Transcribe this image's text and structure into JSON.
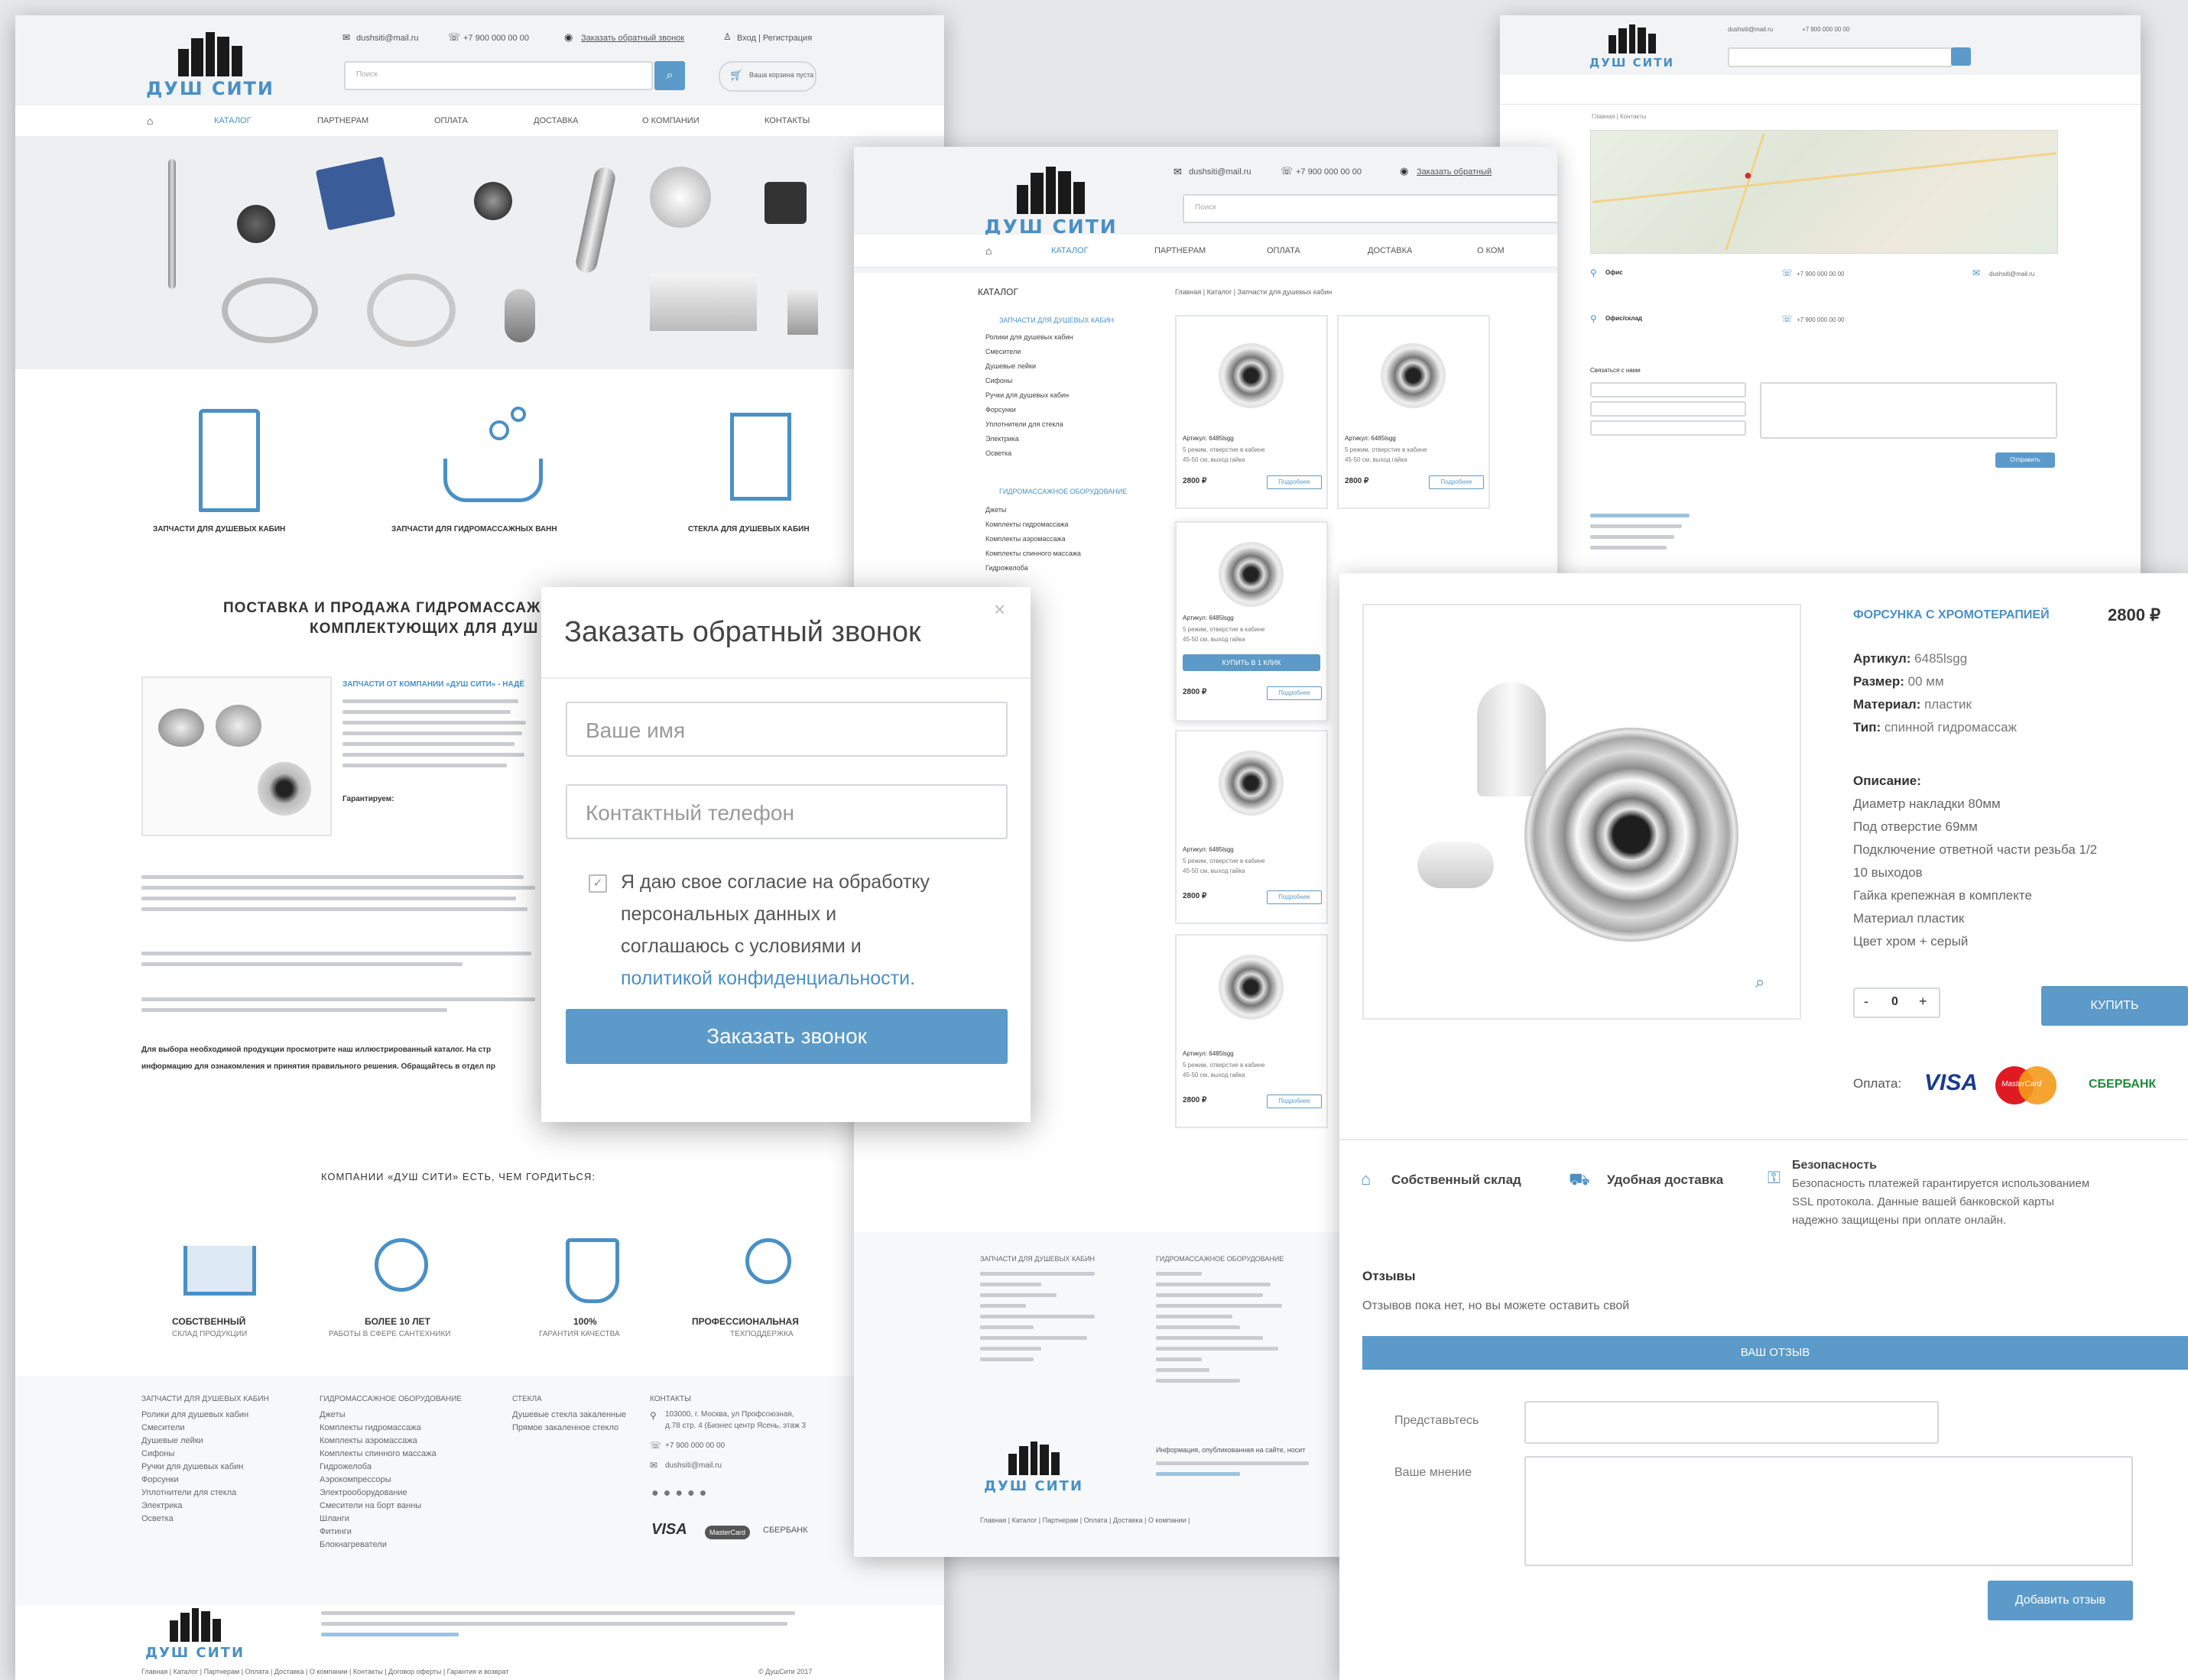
{
  "brand": {
    "name": "ДУШ СИТИ"
  },
  "colors": {
    "accent": "#4a90c5",
    "button": "#5b9ac9",
    "bg": "#e6e7e9"
  },
  "home": {
    "header": {
      "email": "dushsiti@mail.ru",
      "phone": "+7 900 000 00 00",
      "callback_link": "Заказать обратный звонок",
      "login": "Вход | Регистрация",
      "search_placeholder": "Поиск",
      "cart_label": "Ваша корзина пуста"
    },
    "nav": [
      "КАТАЛОГ",
      "ПАРТНЕРАМ",
      "ОПЛАТА",
      "ДОСТАВКА",
      "О КОМПАНИИ",
      "КОНТАКТЫ"
    ],
    "categories": [
      "ЗАПЧАСТИ ДЛЯ ДУШЕВЫХ КАБИН",
      "ЗАПЧАСТИ ДЛЯ ГИДРОМАССАЖНЫХ ВАНН",
      "СТЕКЛА ДЛЯ ДУШЕВЫХ КАБИН"
    ],
    "section_title_1": "ПОСТАВКА И ПРОДАЖА ГИДРОМАССАЖ",
    "section_title_2": "КОМПЛЕКТУЮЩИХ ДЛЯ ДУШ",
    "intro_link": "ЗАПЧАСТИ ОТ КОМПАНИИ «ДУШ СИТИ» - НАДЁ",
    "guarantee": "Гарантируем:",
    "bold_note_1": "Для выбора необходимой продукции просмотрите наш иллюстрированный каталог. На стр",
    "bold_note_2": "информацию для ознакомления и принятия правильного решения. Обращайтесь в отдел пр",
    "proud_title": "КОМПАНИИ «ДУШ СИТИ» ЕСТЬ, ЧЕМ ГОРДИТЬСЯ:",
    "features": [
      {
        "title": "СОБСТВЕННЫЙ",
        "sub": "СКЛАД ПРОДУКЦИИ"
      },
      {
        "title": "БОЛЕЕ 10 ЛЕТ",
        "sub": "РАБОТЫ В СФЕРЕ САНТЕХНИКИ"
      },
      {
        "title": "100%",
        "sub": "ГАРАНТИЯ КАЧЕСТВА"
      },
      {
        "title": "ПРОФЕССИОНАЛЬНАЯ",
        "sub": "ТЕХПОДДЕРЖКА"
      }
    ],
    "footer_cols": [
      {
        "title": "ЗАПЧАСТИ ДЛЯ ДУШЕВЫХ КАБИН",
        "items": [
          "Ролики для душевых кабин",
          "Смесители",
          "Душевые лейки",
          "Сифоны",
          "Ручки для душевых кабин",
          "Форсунки",
          "Уплотнители для стекла",
          "Электрика",
          "Осветка"
        ]
      },
      {
        "title": "ГИДРОМАССАЖНОЕ ОБОРУДОВАНИЕ",
        "items": [
          "Джеты",
          "Комплекты гидромассажа",
          "Комплекты аэромассажа",
          "Комплекты спинного массажа",
          "Гидрожелоба",
          "Аэрокомпрессоры",
          "Электрооборудование",
          "Смесители на борт ванны",
          "Шланги",
          "Фитинги",
          "Блокнагреватели"
        ]
      },
      {
        "title": "СТЕКЛА",
        "items": [
          "Душевые стекла закаленные",
          "Прямое закаленное стекло"
        ]
      },
      {
        "title": "КОНТАКТЫ",
        "items": [
          "103000, г. Москва, ул Профсоюзная,",
          "д.78 стр. 4 (Бизнес центр Ясень, этаж 3",
          "+7 900 000 00 00",
          "dushsiti@mail.ru"
        ]
      }
    ],
    "payments": [
      "VISA",
      "MasterCard",
      "СБЕРБАНК"
    ],
    "copyright": "© ДушСити 2017",
    "bottom_links": "Главная | Каталог | Партнерам | Оплата | Доставка | О компании | Контакты | Договор оферты | Гарантия и возврат"
  },
  "modal": {
    "title": "Заказать обратный звонок",
    "close": "×",
    "name_placeholder": "Ваше имя",
    "phone_placeholder": "Контактный телефон",
    "consent_1": "Я даю свое согласие на обработку",
    "consent_2": "персональных данных и",
    "consent_3": "соглашаюсь с условиями и",
    "consent_link": "политикой конфиденциальности.",
    "submit": "Заказать звонок"
  },
  "catalog": {
    "header_email": "dushsiti@mail.ru",
    "header_phone": "+7 900 000 00 00",
    "header_callback": "Заказать обратный",
    "search_placeholder": "Поиск",
    "nav": [
      "КАТАЛОГ",
      "ПАРТНЕРАМ",
      "ОПЛАТА",
      "ДОСТАВКА",
      "О КОМ"
    ],
    "sidebar_title": "КАТАЛОГ",
    "breadcrumb": "Главная | Каталог | Запчасти для душевых кабин",
    "group1_title": "ЗАПЧАСТИ ДЛЯ ДУШЕВЫХ КАБИН",
    "group1_items": [
      "Ролики для душевых кабин",
      "Смесители",
      "Душевые лейки",
      "Сифоны",
      "Ручки для душевых кабин",
      "Форсунки",
      "Уплотнители для стекла",
      "Электрика",
      "Осветка"
    ],
    "group2_title": "ГИДРОМАССАЖНОЕ ОБОРУДОВАНИЕ",
    "group2_items": [
      "Джеты",
      "Комплекты гидромассажа",
      "Комплекты аэромассажа",
      "Комплекты спинного массажа",
      "Гидрожелоба"
    ],
    "product": {
      "sku": "Артикул: 6485lsgg",
      "desc1": "5 режим, отверстие в кабине",
      "desc2": "45-50 см, выход гайка",
      "price": "2800 ₽",
      "more": "Подробнее",
      "buy": "КУПИТЬ В 1 КЛИК"
    },
    "footer_info": "Информация, опубликованная на сайте, носит",
    "bottom_links": "Главная | Каталог | Партнерам | Оплата | Доставка | О компании |"
  },
  "contacts": {
    "breadcrumb": "Главная | Контакты",
    "office1": "Офис",
    "office2": "Офис/склад",
    "phone": "+7 900 000 00 00",
    "email": "dushsiti@mail.ru",
    "form_title": "Связаться с нами",
    "send": "Отправить"
  },
  "product": {
    "title": "ФОРСУНКА С ХРОМОТЕРАПИЕЙ",
    "price": "2800 ₽",
    "specs": [
      {
        "k": "Артикул:",
        "v": "6485lsgg"
      },
      {
        "k": "Размер:",
        "v": "00 мм"
      },
      {
        "k": "Материал:",
        "v": "пластик"
      },
      {
        "k": "Тип:",
        "v": "спинной гидромассаж"
      }
    ],
    "desc_title": "Описание:",
    "desc": [
      "Диаметр накладки 80мм",
      "Под отверстие 69мм",
      "Подключение ответной части резьба 1/2",
      "10 выходов",
      "Гайка крепежная в комплекте",
      "Материал пластик",
      "Цвет хром + серый"
    ],
    "qty": "0",
    "minus": "-",
    "plus": "+",
    "buy": "КУПИТЬ",
    "payment_label": "Оплата:",
    "pay_visa": "VISA",
    "pay_mc": "MasterCard",
    "pay_sber": "СБЕРБАНК",
    "badge1": "Собственный склад",
    "badge2": "Удобная доставка",
    "badge3_title": "Безопасность",
    "badge3_text_1": "Безопасность платежей гарантируется использованием",
    "badge3_text_2": "SSL протокола. Данные вашей банковской карты",
    "badge3_text_3": "надежно защищены при оплате онлайн.",
    "reviews_title": "Отзывы",
    "reviews_empty": "Отзывов пока нет, но вы можете оставить свой",
    "review_bar": "ВАШ ОТЗЫВ",
    "intro_label": "Представьтесь",
    "opinion_label": "Ваше мнение",
    "add_review": "Добавить отзыв"
  }
}
